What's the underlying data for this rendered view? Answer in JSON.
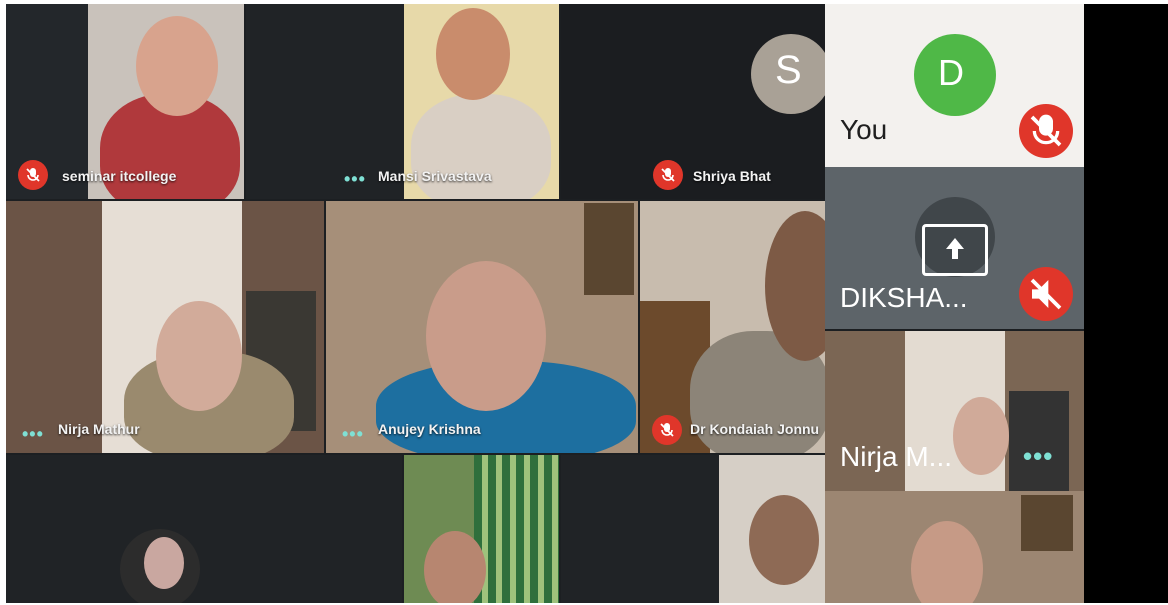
{
  "participants": [
    {
      "name": "seminar itcollege",
      "audio": "muted"
    },
    {
      "name": "Mansi Srivastava",
      "audio": "more"
    },
    {
      "name": "Shriya Bhat",
      "audio": "muted"
    },
    {
      "name": "Nirja Mathur",
      "audio": "more"
    },
    {
      "name": "Anujey Krishna",
      "audio": "more"
    },
    {
      "name": "Dr Kondaiah Jonnu",
      "audio": "muted"
    }
  ],
  "sidebar": {
    "you": {
      "avatar_letter": "D",
      "label": "You",
      "avatar_color": "#4fb847"
    },
    "presenter": {
      "label": "DIKSHA..."
    },
    "self_view": {
      "label": "Nirja M..."
    }
  },
  "shriya_avatar_letter": "S",
  "colors": {
    "muted": "#e0362a",
    "accent_dots": "#7fe0d4"
  }
}
